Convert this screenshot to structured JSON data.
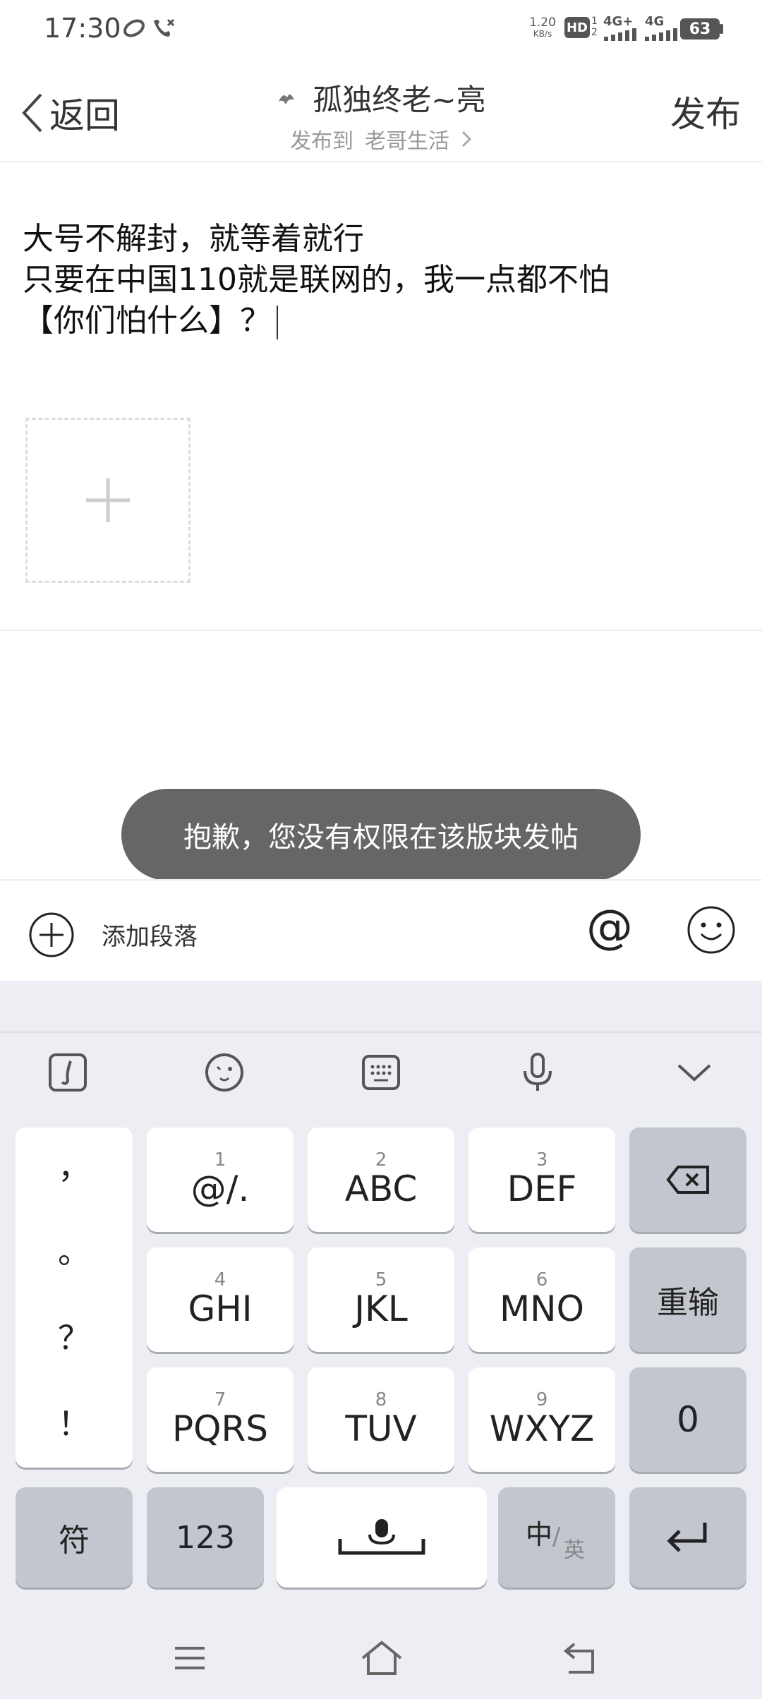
{
  "status_bar": {
    "time": "17:30",
    "network_speed_value": "1.20",
    "network_speed_unit": "KB/s",
    "hd_badge": "HD",
    "sim1_tech": "4G+",
    "sim2_tech": "4G",
    "battery": "63"
  },
  "header": {
    "back_label": "返回",
    "author_name": "孤独终老~亮",
    "publish_to_label": "发布到",
    "board_name": "老哥生活",
    "publish_button": "发布"
  },
  "post": {
    "lines": [
      "大号不解封，就等着就行",
      "只要在中国110就是联网的，我一点都不怕",
      "【你们怕什么】？"
    ]
  },
  "toast": {
    "message": "抱歉，您没有权限在该版块发帖"
  },
  "editor_toolbar": {
    "add_paragraph_label": "添加段落"
  },
  "keyboard": {
    "punctuation": [
      "，",
      "。",
      "？",
      "！"
    ],
    "keys": [
      {
        "num": "1",
        "label": "@/."
      },
      {
        "num": "2",
        "label": "ABC"
      },
      {
        "num": "3",
        "label": "DEF"
      },
      {
        "num": "4",
        "label": "GHI"
      },
      {
        "num": "5",
        "label": "JKL"
      },
      {
        "num": "6",
        "label": "MNO"
      },
      {
        "num": "7",
        "label": "PQRS"
      },
      {
        "num": "8",
        "label": "TUV"
      },
      {
        "num": "9",
        "label": "WXYZ"
      }
    ],
    "reenter_label": "重输",
    "zero_label": "0",
    "symbols_label": "符",
    "numbers_label": "123",
    "lang_main": "中",
    "lang_alt": "英"
  },
  "colors": {
    "toast_bg": "#666666",
    "keyboard_bg": "#eceef3",
    "key_gray": "#c3c6ce"
  }
}
